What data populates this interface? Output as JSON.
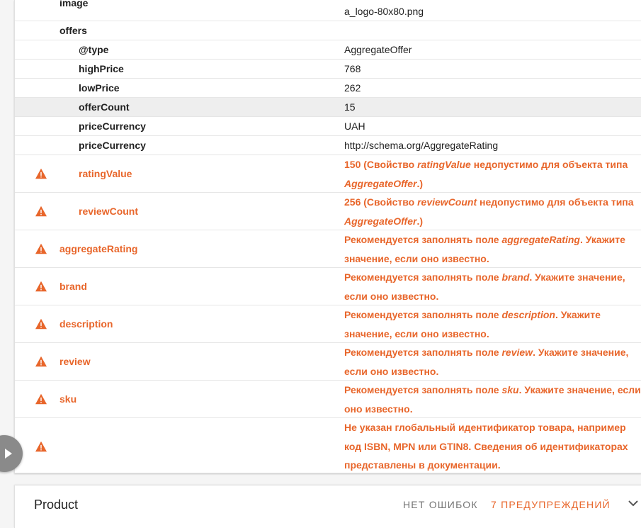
{
  "rows": {
    "image": {
      "key": "image",
      "value": "a_logo-80x80.png"
    },
    "offers": {
      "key": "offers",
      "value": ""
    },
    "type": {
      "key": "@type",
      "value": "AggregateOffer"
    },
    "highPrice": {
      "key": "highPrice",
      "value": "768"
    },
    "lowPrice": {
      "key": "lowPrice",
      "value": "262"
    },
    "offerCount": {
      "key": "offerCount",
      "value": "15"
    },
    "priceCurrency1": {
      "key": "priceCurrency",
      "value": "UAH"
    },
    "priceCurrency2": {
      "key": "priceCurrency",
      "value": "http://schema.org/AggregateRating"
    }
  },
  "warnings": [
    {
      "key": "ratingValue",
      "pre": "150 (Свойство ",
      "em": "ratingValue",
      "mid": " недопустимо для объекта типа ",
      "em2": "AggregateOffer",
      "post": ".)"
    },
    {
      "key": "reviewCount",
      "pre": "256 (Свойство ",
      "em": "reviewCount",
      "mid": " недопустимо для объекта типа ",
      "em2": "AggregateOffer",
      "post": ".)"
    },
    {
      "key": "aggregateRating",
      "pre": "Рекомендуется заполнять поле ",
      "em": "aggregateRating",
      "post": ". Укажите значение, если оно известно."
    },
    {
      "key": "brand",
      "pre": "Рекомендуется заполнять поле ",
      "em": "brand",
      "post": ". Укажите значение, если оно известно."
    },
    {
      "key": "description",
      "pre": "Рекомендуется заполнять поле ",
      "em": "description",
      "post": ". Укажите значение, если оно известно."
    },
    {
      "key": "review",
      "pre": "Рекомендуется заполнять поле ",
      "em": "review",
      "post": ". Укажите значение, если оно известно."
    },
    {
      "key": "sku",
      "pre": "Рекомендуется заполнять поле ",
      "em": "sku",
      "post": ". Укажите значение, если оно известно."
    },
    {
      "key": "",
      "pre": "Не указан глобальный идентификатор товара, например код ISBN, MPN или GTIN8. Сведения об идентификаторах представлены в документации."
    }
  ],
  "product": {
    "title": "Product",
    "no_errors": "НЕТ ОШИБОК",
    "warnings": "7 ПРЕДУПРЕЖДЕНИЙ"
  },
  "colors": {
    "warning": "#e8662b",
    "text": "#212121",
    "muted": "#757575"
  },
  "icons": [
    "warning-icon",
    "play-icon",
    "chevron-down-icon"
  ]
}
